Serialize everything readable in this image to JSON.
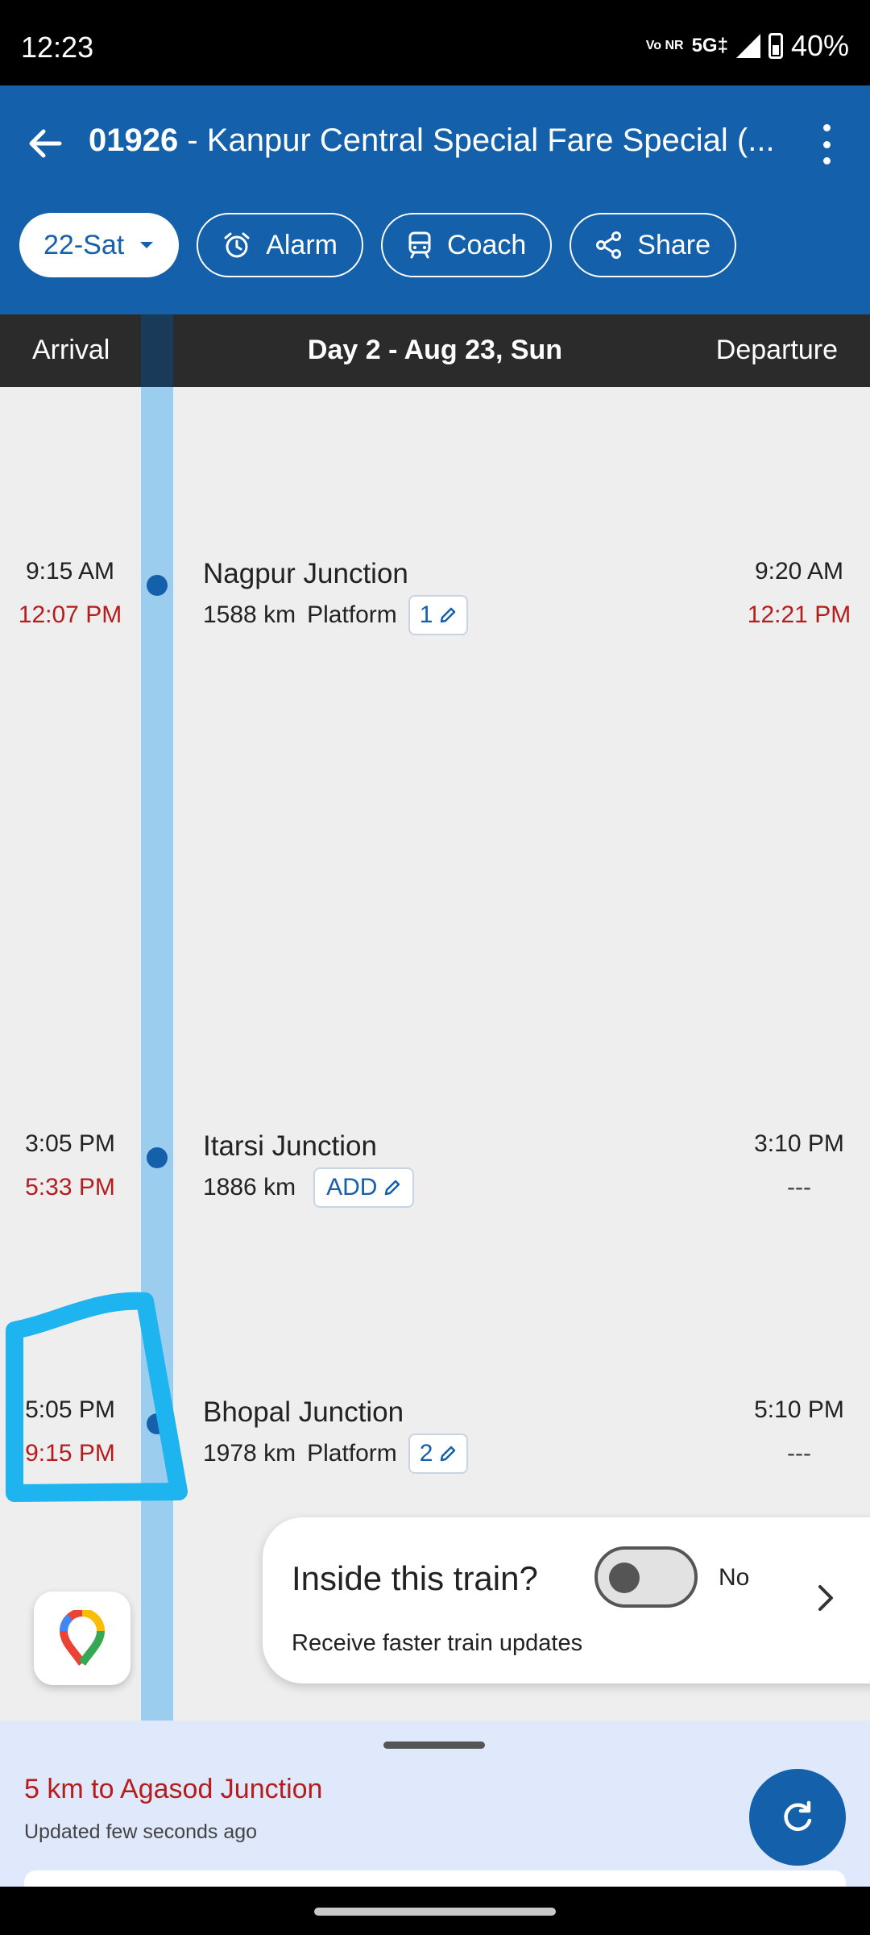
{
  "status_bar": {
    "time": "12:23",
    "volte": "Vo NR",
    "network": "5G‡",
    "battery": "40%"
  },
  "header": {
    "train_number": "01926",
    "title_rest": " - Kanpur Central Special Fare Special (...",
    "back_icon": "arrow-left-icon",
    "more_icon": "more-vertical-icon"
  },
  "chips": {
    "date": "22-Sat",
    "alarm": "Alarm",
    "coach": "Coach",
    "share": "Share"
  },
  "day_header": {
    "arrival": "Arrival",
    "day": "Day 2 - Aug 23, Sun",
    "departure": "Departure"
  },
  "stations": [
    {
      "name": "Nagpur Junction",
      "distance": "1588 km",
      "platform_label": "Platform",
      "platform": "1",
      "arr_sched": "9:15 AM",
      "arr_actual": "12:07 PM",
      "dep_sched": "9:20 AM",
      "dep_actual": "12:21 PM"
    },
    {
      "name": "Itarsi Junction",
      "distance": "1886 km",
      "platform_label": "",
      "platform": "ADD",
      "arr_sched": "3:05 PM",
      "arr_actual": "5:33 PM",
      "dep_sched": "3:10 PM",
      "dep_actual": "---"
    },
    {
      "name": "Bhopal Junction",
      "distance": "1978 km",
      "platform_label": "Platform",
      "platform": "2",
      "arr_sched": "5:05 PM",
      "arr_actual": "9:15 PM",
      "dep_sched": "5:10 PM",
      "dep_actual": "---"
    }
  ],
  "inside_card": {
    "title": "Inside this train?",
    "toggle_label": "No",
    "subtitle": "Receive faster train updates"
  },
  "bottom_sheet": {
    "location": "5 km to Agasod Junction",
    "updated": "Updated few seconds ago"
  },
  "colors": {
    "primary": "#1460aa",
    "delay_red": "#b71c1c",
    "track": "#9bcdef",
    "annotation": "#1eb4f0"
  }
}
